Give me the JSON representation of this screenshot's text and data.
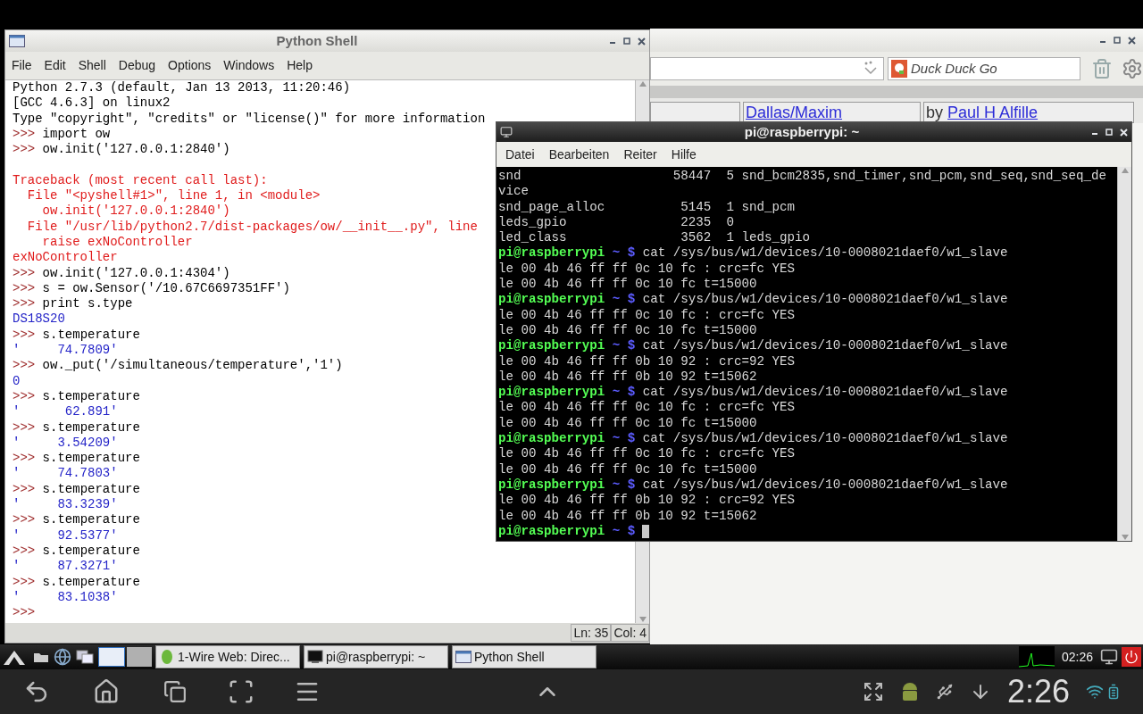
{
  "browser_window": {
    "search_field": {
      "placeholder": "Duck Duck Go"
    },
    "table_row": [
      {
        "kind": "empty"
      },
      {
        "kind": "link",
        "text": "Dallas/Maxim"
      },
      {
        "kind": "byline",
        "prefix": "by",
        "link": "Paul H Alfille"
      }
    ]
  },
  "python_shell": {
    "title": "Python Shell",
    "menu": [
      "File",
      "Edit",
      "Shell",
      "Debug",
      "Options",
      "Windows",
      "Help"
    ],
    "lines": [
      {
        "kind": "banner",
        "text": "Python 2.7.3 (default, Jan 13 2013, 11:20:46)"
      },
      {
        "kind": "banner",
        "text": "[GCC 4.6.3] on linux2"
      },
      {
        "kind": "banner",
        "text": "Type \"copyright\", \"credits\" or \"license()\" for more information"
      },
      {
        "kind": "input",
        "prompt": ">>>",
        "code": "import ow"
      },
      {
        "kind": "input",
        "prompt": ">>>",
        "code": "ow.init('127.0.0.1:2840')"
      },
      {
        "kind": "blank"
      },
      {
        "kind": "error",
        "text": "Traceback (most recent call last):"
      },
      {
        "kind": "error",
        "text": "  File \"<pyshell#1>\", line 1, in <module>"
      },
      {
        "kind": "error",
        "text": "    ow.init('127.0.0.1:2840')"
      },
      {
        "kind": "error",
        "text": "  File \"/usr/lib/python2.7/dist-packages/ow/__init__.py\", line"
      },
      {
        "kind": "error",
        "text": "    raise exNoController"
      },
      {
        "kind": "error",
        "text": "exNoController"
      },
      {
        "kind": "input",
        "prompt": ">>>",
        "code": "ow.init('127.0.0.1:4304')"
      },
      {
        "kind": "input",
        "prompt": ">>>",
        "code": "s = ow.Sensor('/10.67C6697351FF')"
      },
      {
        "kind": "input",
        "prompt": ">>>",
        "code": "print s.type"
      },
      {
        "kind": "output",
        "text": "DS18S20"
      },
      {
        "kind": "input",
        "prompt": ">>>",
        "code": "s.temperature"
      },
      {
        "kind": "output",
        "text": "'     74.7809'"
      },
      {
        "kind": "input",
        "prompt": ">>>",
        "code": "ow._put('/simultaneous/temperature','1')"
      },
      {
        "kind": "output",
        "text": "0"
      },
      {
        "kind": "input",
        "prompt": ">>>",
        "code": "s.temperature"
      },
      {
        "kind": "output",
        "text": "'      62.891'"
      },
      {
        "kind": "input",
        "prompt": ">>>",
        "code": "s.temperature"
      },
      {
        "kind": "output",
        "text": "'     3.54209'"
      },
      {
        "kind": "input",
        "prompt": ">>>",
        "code": "s.temperature"
      },
      {
        "kind": "output",
        "text": "'     74.7803'"
      },
      {
        "kind": "input",
        "prompt": ">>>",
        "code": "s.temperature"
      },
      {
        "kind": "output",
        "text": "'     83.3239'"
      },
      {
        "kind": "input",
        "prompt": ">>>",
        "code": "s.temperature"
      },
      {
        "kind": "output",
        "text": "'     92.5377'"
      },
      {
        "kind": "input",
        "prompt": ">>>",
        "code": "s.temperature"
      },
      {
        "kind": "output",
        "text": "'     87.3271'"
      },
      {
        "kind": "input",
        "prompt": ">>>",
        "code": "s.temperature"
      },
      {
        "kind": "output",
        "text": "'     83.1038'"
      },
      {
        "kind": "input",
        "prompt": ">>>"
      }
    ],
    "status": {
      "line": "Ln: 35",
      "column": "Col: 4"
    }
  },
  "terminal": {
    "title": "pi@raspberrypi: ~",
    "menu": [
      "Datei",
      "Bearbeiten",
      "Reiter",
      "Hilfe"
    ],
    "lines": [
      {
        "kind": "output",
        "text": "snd                    58447  5 snd_bcm2835,snd_timer,snd_pcm,snd_seq,snd_seq_de"
      },
      {
        "kind": "output",
        "text": "vice"
      },
      {
        "kind": "output",
        "text": "snd_page_alloc          5145  1 snd_pcm"
      },
      {
        "kind": "output",
        "text": "leds_gpio               2235  0"
      },
      {
        "kind": "output",
        "text": "led_class               3562  1 leds_gpio"
      },
      {
        "kind": "prompt",
        "user": "pi@raspberrypi",
        "cwd": "~ $",
        "command": "cat /sys/bus/w1/devices/10-0008021daef0/w1_slave"
      },
      {
        "kind": "output",
        "text": "le 00 4b 46 ff ff 0c 10 fc : crc=fc YES"
      },
      {
        "kind": "output",
        "text": "le 00 4b 46 ff ff 0c 10 fc t=15000"
      },
      {
        "kind": "prompt",
        "user": "pi@raspberrypi",
        "cwd": "~ $",
        "command": "cat /sys/bus/w1/devices/10-0008021daef0/w1_slave"
      },
      {
        "kind": "output",
        "text": "le 00 4b 46 ff ff 0c 10 fc : crc=fc YES"
      },
      {
        "kind": "output",
        "text": "le 00 4b 46 ff ff 0c 10 fc t=15000"
      },
      {
        "kind": "prompt",
        "user": "pi@raspberrypi",
        "cwd": "~ $",
        "command": "cat /sys/bus/w1/devices/10-0008021daef0/w1_slave"
      },
      {
        "kind": "output",
        "text": "le 00 4b 46 ff ff 0b 10 92 : crc=92 YES"
      },
      {
        "kind": "output",
        "text": "le 00 4b 46 ff ff 0b 10 92 t=15062"
      },
      {
        "kind": "prompt",
        "user": "pi@raspberrypi",
        "cwd": "~ $",
        "command": "cat /sys/bus/w1/devices/10-0008021daef0/w1_slave"
      },
      {
        "kind": "output",
        "text": "le 00 4b 46 ff ff 0c 10 fc : crc=fc YES"
      },
      {
        "kind": "output",
        "text": "le 00 4b 46 ff ff 0c 10 fc t=15000"
      },
      {
        "kind": "prompt",
        "user": "pi@raspberrypi",
        "cwd": "~ $",
        "command": "cat /sys/bus/w1/devices/10-0008021daef0/w1_slave"
      },
      {
        "kind": "output",
        "text": "le 00 4b 46 ff ff 0c 10 fc : crc=fc YES"
      },
      {
        "kind": "output",
        "text": "le 00 4b 46 ff ff 0c 10 fc t=15000"
      },
      {
        "kind": "prompt",
        "user": "pi@raspberrypi",
        "cwd": "~ $",
        "command": "cat /sys/bus/w1/devices/10-0008021daef0/w1_slave"
      },
      {
        "kind": "output",
        "text": "le 00 4b 46 ff ff 0b 10 92 : crc=92 YES"
      },
      {
        "kind": "output",
        "text": "le 00 4b 46 ff ff 0b 10 92 t=15062"
      },
      {
        "kind": "prompt",
        "user": "pi@raspberrypi",
        "cwd": "~ $",
        "cursor": true
      }
    ]
  },
  "taskbar": {
    "tasks": [
      {
        "kind": "browser",
        "label": "1-Wire Web: Direc..."
      },
      {
        "kind": "terminal",
        "label": "pi@raspberrypi: ~"
      },
      {
        "kind": "window",
        "label": "Python Shell"
      }
    ],
    "clock": "02:26"
  },
  "android_bar": {
    "clock": "2:26"
  }
}
